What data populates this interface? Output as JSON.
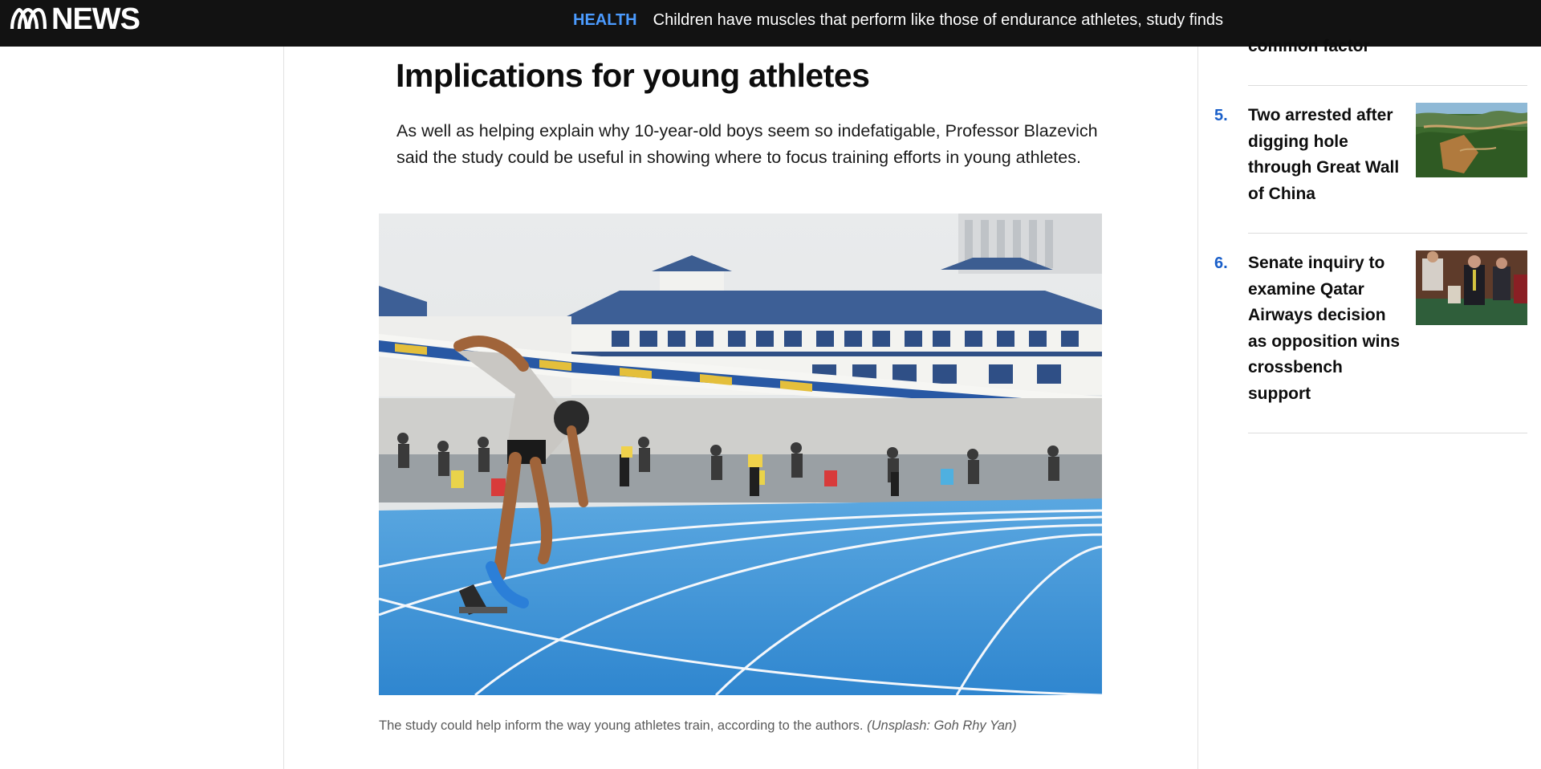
{
  "header": {
    "logo_text": "NEWS",
    "section_label": "HEALTH",
    "headline": "Children have muscles that perform like those of endurance athletes, study finds"
  },
  "article": {
    "heading": "Implications for young athletes",
    "paragraph": "As well as helping explain why 10-year-old boys seem so indefatigable, Professor Blazevich said the study could be useful in showing where to focus training efforts in young athletes.",
    "image_icon": "track-sprinter-photo",
    "caption": "The study could help inform the way young athletes train, according to the authors.",
    "caption_credit": "(Unsplash: Goh Rhy Yan)"
  },
  "sidebar": {
    "partial_item_text": "common factor",
    "items": [
      {
        "number": "5.",
        "title": "Two arrested after digging hole through Great Wall of China",
        "thumbnail_icon": "great-wall-photo"
      },
      {
        "number": "6.",
        "title": "Senate inquiry to examine Qatar Airways decision as opposition wins crossbench support",
        "thumbnail_icon": "senate-chamber-photo"
      }
    ]
  },
  "colors": {
    "topbar": "#121212",
    "section_label": "#4b9bff",
    "list_number": "#1a5fc9",
    "track_blue": "#3a8fd6"
  }
}
